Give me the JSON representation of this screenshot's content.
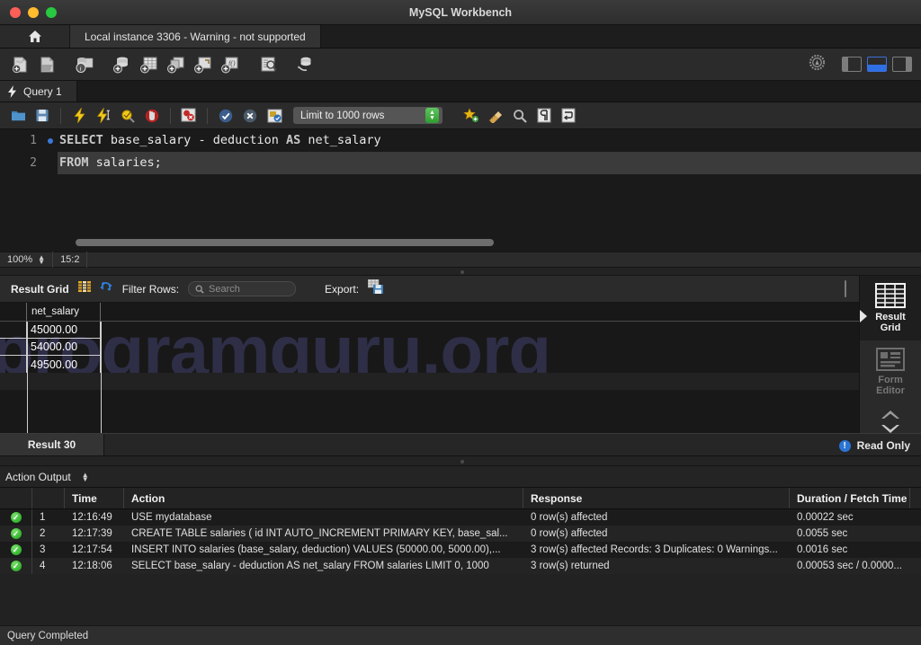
{
  "window": {
    "title": "MySQL Workbench",
    "traffic_lights": [
      "close",
      "minimize",
      "maximize"
    ]
  },
  "instance_tabs": {
    "home_icon": "home-icon",
    "active_tab": "Local instance 3306 - Warning - not supported"
  },
  "main_toolbar": {
    "icons": [
      "new-sql-file-icon",
      "open-sql-file-icon",
      "table-inspector-icon",
      "new-schema-icon",
      "new-table-icon",
      "new-view-icon",
      "new-procedure-icon",
      "new-function-icon",
      "search-data-icon",
      "reconnect-server-icon"
    ],
    "right_icons": [
      "settings-gear-icon",
      "toggle-left-panel",
      "toggle-bottom-panel",
      "toggle-right-panel"
    ]
  },
  "query_tab": {
    "label": "Query 1",
    "icon": "lightning-icon"
  },
  "editor_toolbar": {
    "icons": [
      "open-file-icon",
      "save-file-icon",
      "execute-icon",
      "execute-current-icon",
      "explain-icon",
      "stop-icon",
      "stop-on-error-icon",
      "commit-icon",
      "rollback-icon",
      "autocommit-icon"
    ],
    "limit_label": "Limit to 1000 rows",
    "right_icons": [
      "beautify-icon",
      "clear-context-icon",
      "find-icon",
      "invisible-chars-icon",
      "wrap-lines-icon"
    ]
  },
  "editor": {
    "zoom": "100%",
    "cursor_position": "15:2",
    "lines": [
      {
        "number": "1",
        "breakpoint": true,
        "highlighted": false,
        "tokens": [
          {
            "t": "SELECT",
            "c": "kw"
          },
          {
            "t": " base_salary ",
            "c": "id"
          },
          {
            "t": "- ",
            "c": "op"
          },
          {
            "t": "deduction ",
            "c": "id"
          },
          {
            "t": "AS",
            "c": "kw"
          },
          {
            "t": " net_salary",
            "c": "id"
          }
        ]
      },
      {
        "number": "2",
        "breakpoint": false,
        "highlighted": true,
        "tokens": [
          {
            "t": "FROM",
            "c": "kw"
          },
          {
            "t": " salaries;",
            "c": "id"
          }
        ]
      }
    ]
  },
  "result_toolbar": {
    "title": "Result Grid",
    "grid_icon": "grid-colors-icon",
    "refresh_icon": "refresh-icon",
    "filter_label": "Filter Rows:",
    "search_placeholder": "Search",
    "search_value": "",
    "search_icon": "magnifier-icon",
    "export_label": "Export:",
    "export_icon": "export-recordset-icon",
    "fullscreen_icon": "maximize-grid-icon"
  },
  "result_grid": {
    "watermark": "programguru.org",
    "columns": [
      "net_salary"
    ],
    "rows": [
      [
        "45000.00"
      ],
      [
        "54000.00"
      ],
      [
        "49500.00"
      ]
    ]
  },
  "right_sidebar": {
    "items": [
      {
        "label": "Result\nGrid",
        "label_line1": "Result",
        "label_line2": "Grid",
        "icon": "result-grid-icon",
        "active": true
      },
      {
        "label": "Form\nEditor",
        "label_line1": "Form",
        "label_line2": "Editor",
        "icon": "form-editor-icon",
        "active": false
      }
    ],
    "chevrons": "chevron-up-down-icon"
  },
  "result_tabs": {
    "active": "Result 30",
    "read_only_label": "Read Only",
    "read_only_icon": "info-icon"
  },
  "action_output": {
    "panel_label": "Action Output",
    "selector_icon": "up-down-selector-icon",
    "columns": [
      "",
      "",
      "Time",
      "Action",
      "Response",
      "Duration / Fetch Time"
    ],
    "rows": [
      {
        "status": "ok",
        "no": "1",
        "time": "12:16:49",
        "action": "USE mydatabase",
        "response": "0 row(s) affected",
        "duration": "0.00022 sec"
      },
      {
        "status": "ok",
        "no": "2",
        "time": "12:17:39",
        "action": "CREATE TABLE salaries (    id INT AUTO_INCREMENT PRIMARY KEY,    base_sal...",
        "response": "0 row(s) affected",
        "duration": "0.0055 sec"
      },
      {
        "status": "ok",
        "no": "3",
        "time": "12:17:54",
        "action": "INSERT INTO salaries (base_salary, deduction) VALUES (50000.00, 5000.00),...",
        "response": "3 row(s) affected Records: 3  Duplicates: 0  Warnings...",
        "duration": "0.0016 sec"
      },
      {
        "status": "ok",
        "no": "4",
        "time": "12:18:06",
        "action": "SELECT base_salary - deduction AS net_salary FROM salaries LIMIT 0, 1000",
        "response": "3 row(s) returned",
        "duration": "0.00053 sec / 0.0000..."
      }
    ]
  },
  "status_bar": {
    "message": "Query Completed"
  },
  "colors": {
    "accent_blue": "#2f6fe4",
    "success_green": "#16a016",
    "watermark": "#343352",
    "keyword": "#c8c8c8"
  }
}
